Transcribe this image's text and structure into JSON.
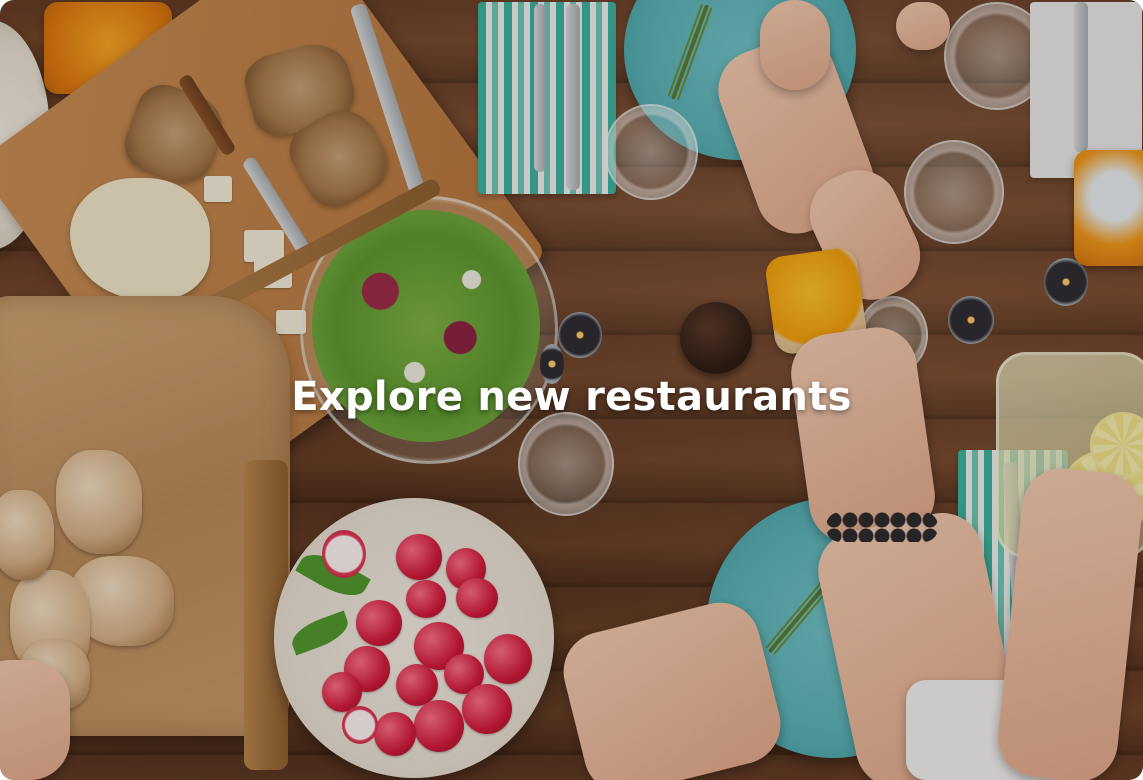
{
  "hero": {
    "headline": "Explore new restaurants",
    "background_image": "dinner-table-food-photo"
  },
  "colors": {
    "headline_text": "#ffffff",
    "table_wood": "#6b4028",
    "plate_teal": "#58b3b9"
  }
}
